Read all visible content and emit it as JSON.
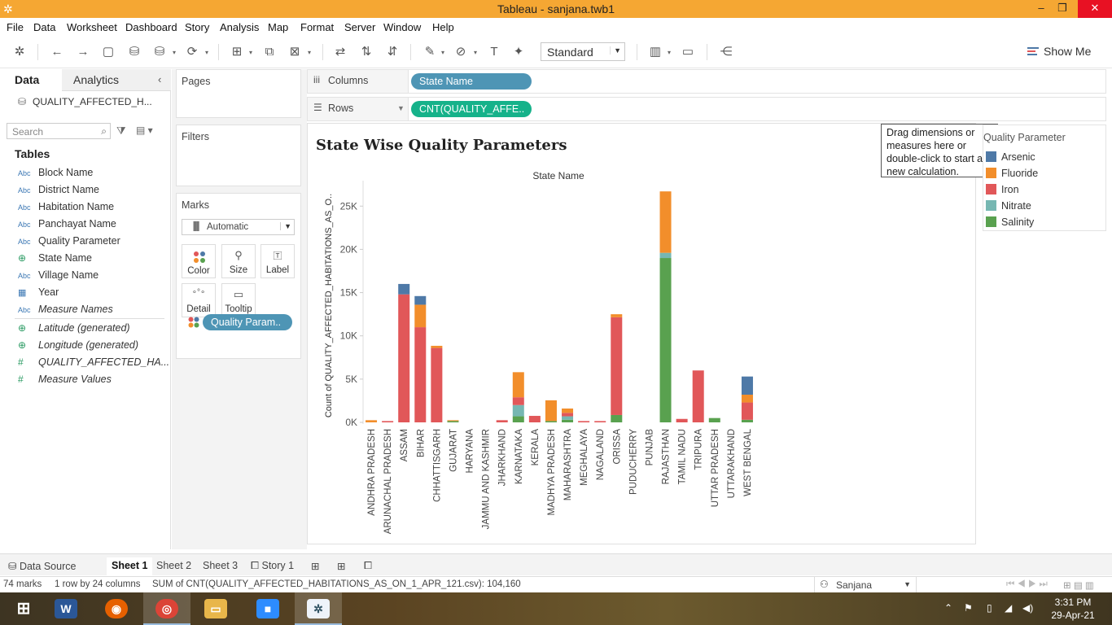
{
  "window": {
    "title": "Tableau - sanjana.twb1"
  },
  "menu": [
    "File",
    "Data",
    "Worksheet",
    "Dashboard",
    "Story",
    "Analysis",
    "Map",
    "Format",
    "Server",
    "Window",
    "Help"
  ],
  "toolbar": {
    "fit_select": "Standard",
    "show_me": "Show Me"
  },
  "data_pane": {
    "tab_data": "Data",
    "tab_analytics": "Analytics",
    "datasource": "QUALITY_AFFECTED_H...",
    "search_placeholder": "Search",
    "tables_title": "Tables",
    "fields": [
      {
        "type": "Abc",
        "name": "Block Name"
      },
      {
        "type": "Abc",
        "name": "District Name"
      },
      {
        "type": "Abc",
        "name": "Habitation Name"
      },
      {
        "type": "Abc",
        "name": "Panchayat Name"
      },
      {
        "type": "Abc",
        "name": "Quality Parameter"
      },
      {
        "type": "geo",
        "name": "State Name"
      },
      {
        "type": "Abc",
        "name": "Village Name"
      },
      {
        "type": "cal",
        "name": "Year"
      },
      {
        "type": "Abc",
        "name": "Measure Names"
      }
    ],
    "measures": [
      {
        "type": "geo",
        "name": "Latitude (generated)"
      },
      {
        "type": "geo",
        "name": "Longitude (generated)"
      },
      {
        "type": "#",
        "name": "QUALITY_AFFECTED_HA..."
      },
      {
        "type": "#",
        "name": "Measure Values"
      }
    ]
  },
  "shelves": {
    "pages": "Pages",
    "filters": "Filters",
    "marks": "Marks",
    "marks_type": "Automatic",
    "mark_buttons": [
      "Color",
      "Size",
      "Label",
      "Detail",
      "Tooltip"
    ],
    "marks_pill": "Quality Param..",
    "columns_label": "Columns",
    "columns_pill": "State Name",
    "rows_label": "Rows",
    "rows_pill": "CNT(QUALITY_AFFE.."
  },
  "hint": "Drag dimensions or measures here or double-click to start a new calculation.",
  "legend": {
    "title": "Quality Parameter",
    "items": [
      {
        "name": "Arsenic",
        "color": "#4e79a7"
      },
      {
        "name": "Fluoride",
        "color": "#f28e2b"
      },
      {
        "name": "Iron",
        "color": "#e15759"
      },
      {
        "name": "Nitrate",
        "color": "#76b7b2"
      },
      {
        "name": "Salinity",
        "color": "#59a14f"
      }
    ]
  },
  "chart_data": {
    "type": "bar",
    "stacked": true,
    "title": "State Wise Quality Parameters",
    "column_header": "State Name",
    "ylabel": "Count of QUALITY_AFFECTED_HABITATIONS_AS_O..",
    "ylim": [
      0,
      27000
    ],
    "yticks": [
      "0K",
      "5K",
      "10K",
      "15K",
      "20K",
      "25K"
    ],
    "ytick_values": [
      0,
      5000,
      10000,
      15000,
      20000,
      25000
    ],
    "categories": [
      "ANDHRA PRADESH",
      "ARUNACHAL PRADESH",
      "ASSAM",
      "BIHAR",
      "CHHATTISGARH",
      "GUJARAT",
      "HARYANA",
      "JAMMU AND KASHMIR",
      "JHARKHAND",
      "KARNATAKA",
      "KERALA",
      "MADHYA PRADESH",
      "MAHARASHTRA",
      "MEGHALAYA",
      "NAGALAND",
      "ORISSA",
      "PUDUCHERRY",
      "PUNJAB",
      "RAJASTHAN",
      "TAMIL NADU",
      "TRIPURA",
      "UTTAR PRADESH",
      "UTTARAKHAND",
      "WEST BENGAL"
    ],
    "series": [
      {
        "name": "Salinity",
        "color": "#59a14f",
        "values": [
          0,
          0,
          0,
          0,
          0,
          150,
          0,
          0,
          0,
          700,
          0,
          150,
          300,
          0,
          0,
          850,
          0,
          0,
          19000,
          0,
          0,
          500,
          0,
          300
        ]
      },
      {
        "name": "Nitrate",
        "color": "#76b7b2",
        "values": [
          0,
          0,
          0,
          0,
          0,
          0,
          0,
          0,
          0,
          1300,
          0,
          0,
          400,
          0,
          0,
          0,
          0,
          0,
          600,
          0,
          0,
          0,
          0,
          0
        ]
      },
      {
        "name": "Iron",
        "color": "#e15759",
        "values": [
          0,
          150,
          14800,
          11000,
          8600,
          0,
          0,
          0,
          250,
          900,
          750,
          0,
          400,
          150,
          150,
          11300,
          0,
          0,
          0,
          400,
          6000,
          0,
          0,
          2000
        ]
      },
      {
        "name": "Fluoride",
        "color": "#f28e2b",
        "values": [
          250,
          0,
          0,
          2600,
          250,
          100,
          0,
          0,
          0,
          2900,
          0,
          2400,
          500,
          0,
          0,
          350,
          0,
          0,
          7100,
          0,
          0,
          0,
          0,
          900
        ]
      },
      {
        "name": "Arsenic",
        "color": "#4e79a7",
        "values": [
          0,
          0,
          1200,
          1000,
          0,
          0,
          0,
          0,
          0,
          0,
          0,
          0,
          0,
          0,
          0,
          0,
          0,
          0,
          0,
          0,
          0,
          0,
          0,
          2100
        ]
      }
    ]
  },
  "bottom_tabs": {
    "data_source": "Data Source",
    "sheets": [
      "Sheet 1",
      "Sheet 2",
      "Sheet 3"
    ],
    "story": "Story 1"
  },
  "status": {
    "marks": "74 marks",
    "dims": "1 row by 24 columns",
    "sum": "SUM of CNT(QUALITY_AFFECTED_HABITATIONS_AS_ON_1_APR_121.csv): 104,160",
    "user": "Sanjana"
  },
  "taskbar": {
    "time": "3:31 PM",
    "date": "29-Apr-21"
  }
}
